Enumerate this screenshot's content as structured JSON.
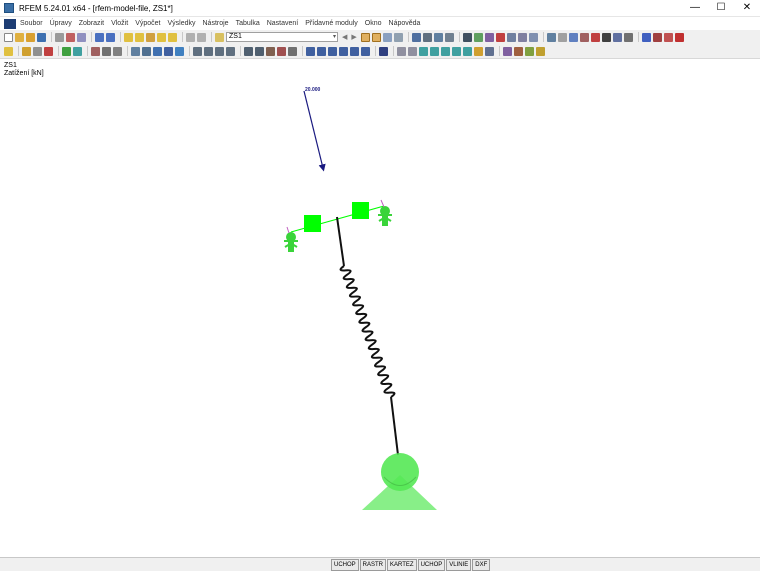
{
  "window": {
    "title": "RFEM 5.24.01 x64 - [rfem-model-file, ZS1*]",
    "controls": {
      "minimize": "—",
      "maximize": "☐",
      "close": "✕"
    }
  },
  "menu": {
    "items": [
      "Soubor",
      "Úpravy",
      "Zobrazit",
      "Vložit",
      "Výpočet",
      "Výsledky",
      "Nástroje",
      "Tabulka",
      "Nastavení",
      "Přídavné moduly",
      "Okno",
      "Nápověda"
    ]
  },
  "toolbar": {
    "load_case": "ZS1"
  },
  "panel": {
    "title": "ZS1",
    "subtitle": "Zatížení [kN]"
  },
  "model": {
    "force_value": "20.000",
    "colors": {
      "member": "#00ff00",
      "support": "#55e855",
      "force": "#1a1a80",
      "spring": "#111111",
      "hinge": "#3ad43a"
    }
  },
  "statusbar": {
    "buttons": [
      "UCHOP",
      "RASTR",
      "KARTEZ",
      "UCHOP",
      "VLINIE",
      "DXF"
    ]
  }
}
